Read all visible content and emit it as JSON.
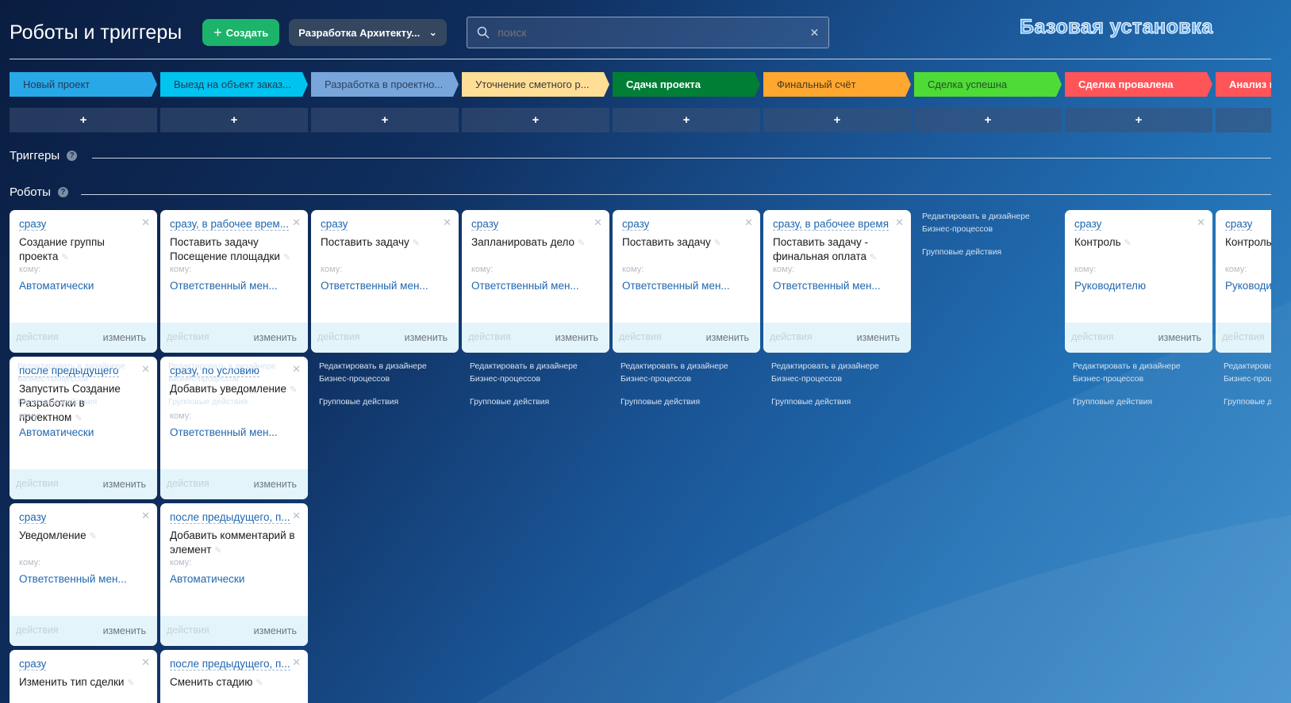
{
  "header": {
    "title": "Роботы и триггеры",
    "create_label": "Создать",
    "pipeline": "Разработка Архитекту...",
    "search_placeholder": "поиск",
    "base_label": "Базовая установка"
  },
  "sections": {
    "triggers": "Триггеры",
    "robots": "Роботы"
  },
  "common": {
    "to": "кому:",
    "actions": "действия",
    "change": "изменить",
    "edit_designer": "Редактировать в дизайнере Бизнес-процессов",
    "group_actions": "Групповые действия",
    "add": "+"
  },
  "columns": [
    {
      "stage": "Новый проект",
      "color": "#29a8e8",
      "text": "#243a52",
      "robots": [
        {
          "cond": "сразу",
          "name": "Создание группы проекта",
          "who": "Автоматически"
        },
        {
          "cond": "после предыдущего",
          "name": "Запустить Создание Разработки в проектном",
          "who": "Автоматически"
        },
        {
          "cond": "сразу",
          "name": "Уведомление",
          "who": "Ответственный мен..."
        },
        {
          "cond": "сразу",
          "name": "Изменить тип сделки",
          "who": ""
        }
      ]
    },
    {
      "stage": "Выезд на объект заказ...",
      "color": "#00c3f0",
      "text": "#243a52",
      "robots": [
        {
          "cond": "сразу, в рабочее врем...",
          "name": "Поставить задачу Посещение площадки",
          "who": "Ответственный мен..."
        },
        {
          "cond": "сразу, по условию",
          "name": "Добавить уведомление",
          "who": "Ответственный мен..."
        },
        {
          "cond": "после предыдущего, п...",
          "name": "Добавить комментарий в элемент",
          "who": "Автоматически"
        },
        {
          "cond": "после предыдущего, п...",
          "name": "Сменить стадию",
          "who": ""
        }
      ]
    },
    {
      "stage": "Разработка в проектно...",
      "color": "#78a6da",
      "text": "#2d4260",
      "robots": [
        {
          "cond": "сразу",
          "name": "Поставить задачу",
          "who": "Ответственный мен..."
        }
      ]
    },
    {
      "stage": "Уточнение сметного р...",
      "color": "#ffde95",
      "text": "#3a3a3a",
      "robots": [
        {
          "cond": "сразу",
          "name": "Запланировать дело",
          "who": "Ответственный мен..."
        }
      ]
    },
    {
      "stage": "Сдача проекта",
      "color": "#017e35",
      "text": "#ffffff",
      "robots": [
        {
          "cond": "сразу",
          "name": "Поставить задачу",
          "who": "Ответственный мен..."
        }
      ]
    },
    {
      "stage": "Финальный счёт",
      "color": "#ffa72e",
      "text": "#4a3a20",
      "robots": [
        {
          "cond": "сразу, в рабочее время",
          "name": "Поставить задачу - финальная оплата",
          "who": "Ответственный мен..."
        }
      ]
    },
    {
      "stage": "Сделка успешна",
      "color": "#4fdb36",
      "text": "#26502a",
      "robots": []
    },
    {
      "stage": "Сделка провалена",
      "color": "#ff5458",
      "text": "#ffffff",
      "robots": [
        {
          "cond": "сразу",
          "name": "Контроль",
          "who": "Руководителю"
        }
      ]
    },
    {
      "stage": "Анализ п",
      "color": "#ff5458",
      "text": "#ffffff",
      "robots": [
        {
          "cond": "сразу",
          "name": "Контроль",
          "who": "Руководителю"
        }
      ]
    }
  ]
}
